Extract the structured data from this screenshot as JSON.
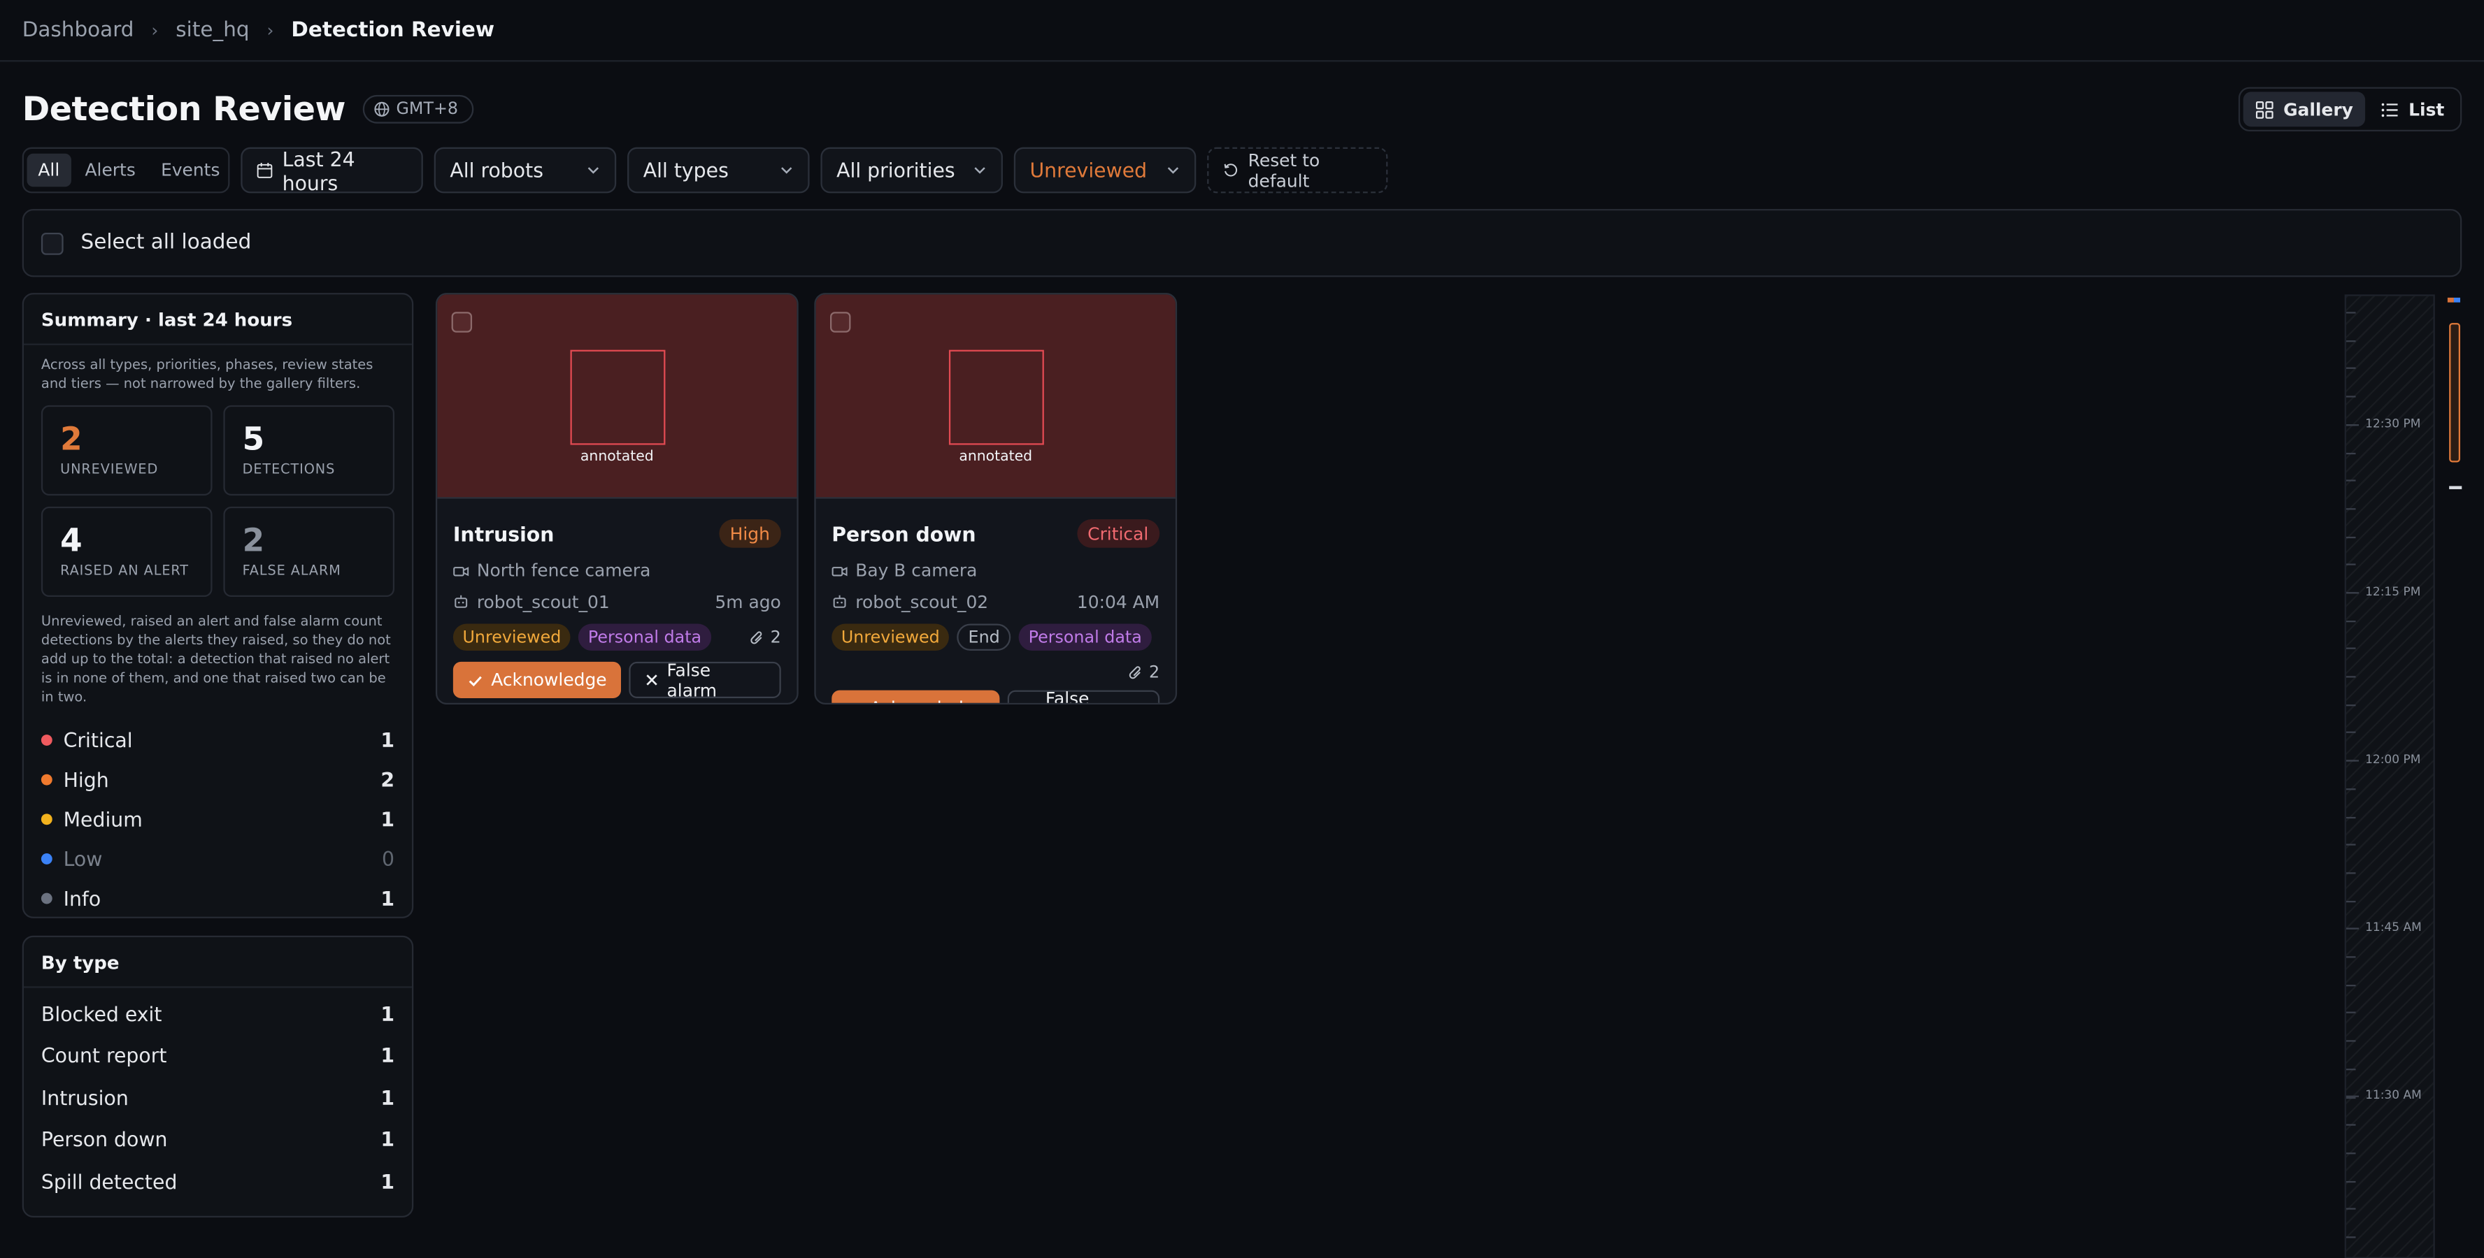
{
  "breadcrumb": {
    "items": [
      "Dashboard",
      "site_hq"
    ],
    "current": "Detection Review"
  },
  "header": {
    "title": "Detection Review",
    "timezone": "GMT+8"
  },
  "view_toggle": {
    "gallery": "Gallery",
    "list": "List",
    "active": "gallery"
  },
  "filters": {
    "kind_tabs": [
      "All",
      "Alerts",
      "Events"
    ],
    "kind_active": "All",
    "range": "Last 24 hours",
    "robots": "All robots",
    "types": "All types",
    "priorities": "All priorities",
    "review_state": "Unreviewed",
    "reset": "Reset to default"
  },
  "select_all": {
    "label": "Select all loaded"
  },
  "summary": {
    "title": "Summary · last 24 hours",
    "note": "Across all types, priorities, phases, review states and tiers — not narrowed by the gallery filters.",
    "stats": [
      {
        "value": "2",
        "label": "UNREVIEWED"
      },
      {
        "value": "5",
        "label": "DETECTIONS"
      },
      {
        "value": "4",
        "label": "RAISED AN ALERT"
      },
      {
        "value": "2",
        "label": "FALSE ALARM"
      }
    ],
    "footnote": "Unreviewed, raised an alert and false alarm count detections by the alerts they raised, so they do not add up to the total: a detection that raised no alert is in none of them, and one that raised two can be in two.",
    "priorities": [
      {
        "name": "Critical",
        "count": "1",
        "color": "#ef5a5f"
      },
      {
        "name": "High",
        "count": "2",
        "color": "#f07a2e"
      },
      {
        "name": "Medium",
        "count": "1",
        "color": "#f2b21e"
      },
      {
        "name": "Low",
        "count": "0",
        "color": "#3b82f6"
      },
      {
        "name": "Info",
        "count": "1",
        "color": "#6b7280"
      }
    ]
  },
  "by_type": {
    "title": "By type",
    "rows": [
      {
        "name": "Blocked exit",
        "count": "1"
      },
      {
        "name": "Count report",
        "count": "1"
      },
      {
        "name": "Intrusion",
        "count": "1"
      },
      {
        "name": "Person down",
        "count": "1"
      },
      {
        "name": "Spill detected",
        "count": "1"
      }
    ]
  },
  "cards": [
    {
      "thumb_label": "annotated",
      "title": "Intrusion",
      "priority": "High",
      "camera": "North fence camera",
      "robot": "robot_scout_01",
      "time": "5m ago",
      "chips": [
        "Unreviewed",
        "Personal data"
      ],
      "attachments": "2",
      "acknowledge": "Acknowledge",
      "false_alarm": "False alarm"
    },
    {
      "thumb_label": "annotated",
      "title": "Person down",
      "priority": "Critical",
      "camera": "Bay B camera",
      "robot": "robot_scout_02",
      "time": "10:04 AM",
      "chips": [
        "Unreviewed",
        "End",
        "Personal data"
      ],
      "attachments": "2",
      "acknowledge": "Acknowledge",
      "false_alarm": "False alarm"
    }
  ],
  "timeline": {
    "labels": [
      "12:30 PM",
      "12:15 PM",
      "12:00 PM",
      "11:45 AM",
      "11:30 AM"
    ]
  }
}
